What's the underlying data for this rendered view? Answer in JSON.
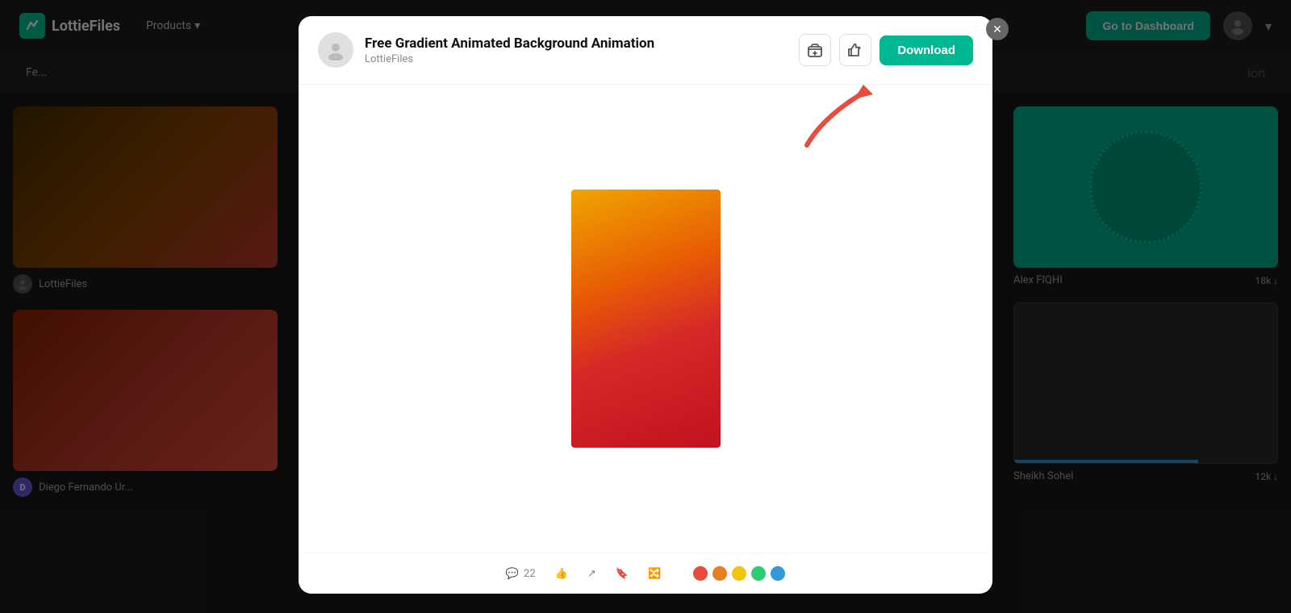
{
  "site": {
    "logo_text": "LottieFiles",
    "logo_icon": "✏"
  },
  "navbar": {
    "products_label": "Products",
    "products_chevron": "▾",
    "dashboard_btn": "Go to Dashboard",
    "avatar_chevron": "▾"
  },
  "subnav": {
    "items": [
      {
        "label": "Fe..."
      },
      {
        "label": "ion"
      }
    ]
  },
  "bg_cards": {
    "left_card1": {
      "author": "LottieFiles",
      "bg_color": "gradient-warm"
    },
    "left_card2": {
      "author": "Diego Fernando Ur...",
      "author_initial": "D"
    },
    "right_card1": {
      "author": "Alex FIQHI",
      "count": "18k",
      "count_icon": "↓"
    },
    "right_card2": {
      "author": "Sheikh Sohel",
      "count": "12k",
      "count_icon": "↓"
    }
  },
  "modal": {
    "title": "Free Gradient Animated Background Animation",
    "subtitle": "LottieFiles",
    "download_btn": "Download",
    "close_icon": "✕",
    "add_to_folder_icon": "📁",
    "like_icon": "👍",
    "bottom_icons": {
      "comments_icon": "💬",
      "comments_count": "22",
      "like_icon": "👍",
      "like_count": "",
      "share_icon": "↗",
      "bookmark_icon": "🔖",
      "remix_icon": "🔀"
    },
    "color_dots": [
      "#e74c3c",
      "#e67e22",
      "#f1c40f",
      "#2ecc71",
      "#3498db"
    ]
  }
}
